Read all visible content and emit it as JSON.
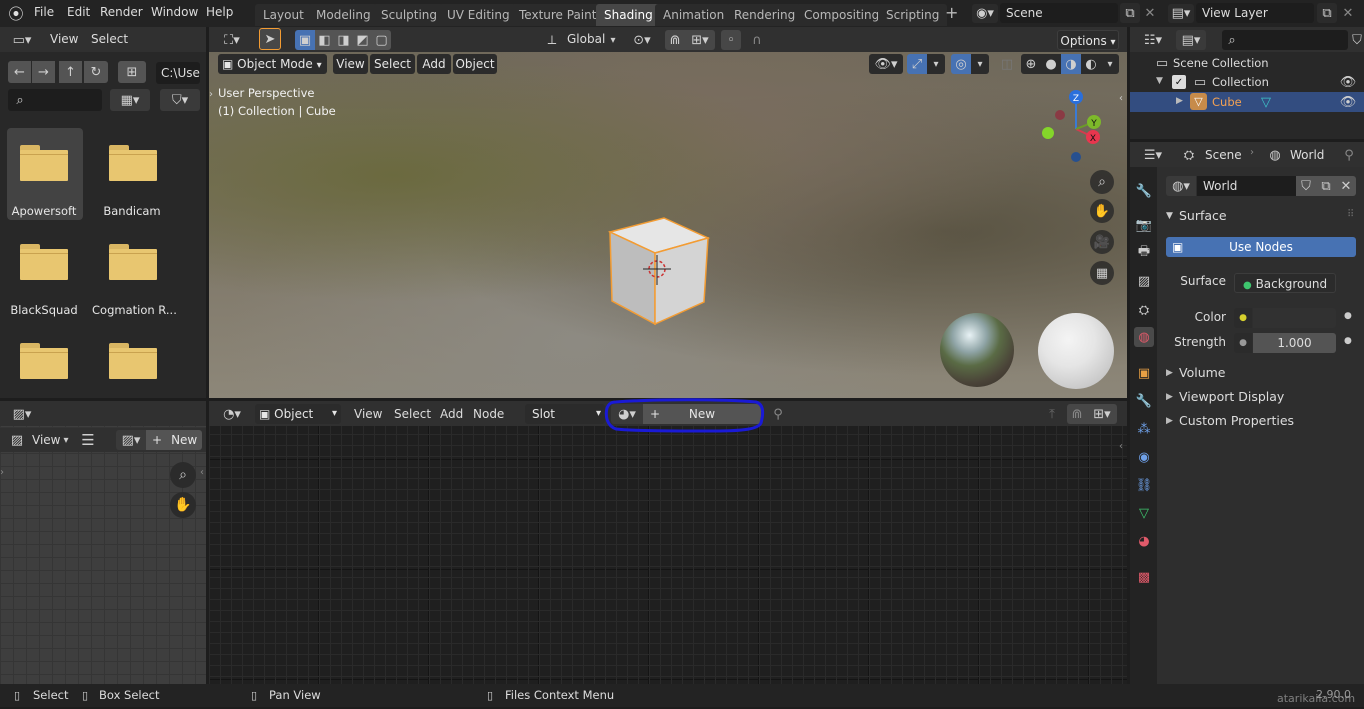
{
  "topbar": {
    "menus": [
      "File",
      "Edit",
      "Render",
      "Window",
      "Help"
    ],
    "workspaces": [
      "Layout",
      "Modeling",
      "Sculpting",
      "UV Editing",
      "Texture Paint",
      "Shading",
      "Animation",
      "Rendering",
      "Compositing",
      "Scripting"
    ],
    "active_workspace": "Shading",
    "add_workspace_symbol": "+",
    "scene_name": "Scene",
    "view_layer_name": "View Layer"
  },
  "file_browser": {
    "menus": [
      "View",
      "Select"
    ],
    "path": "C:\\Use",
    "folders": [
      "Apowersoft",
      "Bandicam",
      "BlackSquad",
      "Cogmation R...",
      "",
      ""
    ]
  },
  "image_editor": {
    "view_label": "View",
    "new_label": "New",
    "plus_symbol": "+"
  },
  "viewport": {
    "mode": "Object Mode",
    "menus": [
      "View",
      "Select",
      "Add",
      "Object"
    ],
    "transform_orientation": "Global",
    "options_label": "Options",
    "overlay_line1": "User Perspective",
    "overlay_line2": "(1) Collection | Cube",
    "gizmo_axes": [
      "Z",
      "Y",
      "X"
    ]
  },
  "node_editor": {
    "object_label": "Object",
    "menus": [
      "View",
      "Select",
      "Add",
      "Node"
    ],
    "slot_label": "Slot",
    "new_label": "New",
    "plus_symbol": "+"
  },
  "outliner": {
    "items": [
      "Scene Collection",
      "Collection",
      "Cube"
    ]
  },
  "properties": {
    "breadcrumb_scene": "Scene",
    "breadcrumb_world": "World",
    "world_name": "World",
    "surface_section": "Surface",
    "use_nodes_label": "Use Nodes",
    "surface_label": "Surface",
    "surface_value": "Background",
    "color_label": "Color",
    "strength_label": "Strength",
    "strength_value": "1.000",
    "collapsed_sections": [
      "Volume",
      "Viewport Display",
      "Custom Properties"
    ]
  },
  "statusbar": {
    "select": "Select",
    "box_select": "Box Select",
    "pan_view": "Pan View",
    "context_menu": "Files Context Menu",
    "version": "2.90.0"
  },
  "watermark": "atarikaila.com",
  "colors": {
    "accent_blue": "#4772b3",
    "selection_outline": "#f39c33",
    "annotation_circle": "#1a1ad6",
    "active_object": "#f2a153"
  }
}
